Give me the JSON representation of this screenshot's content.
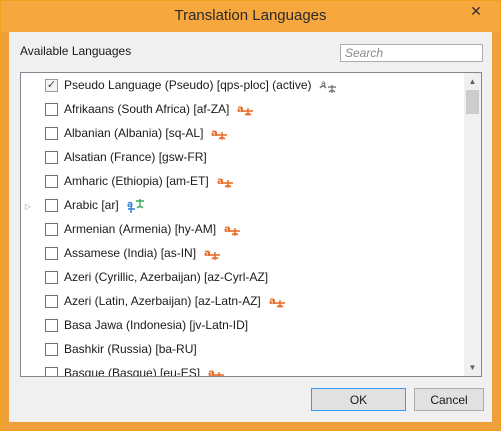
{
  "window": {
    "title": "Translation Languages",
    "close_glyph": "✕"
  },
  "available_label": "Available Languages",
  "search": {
    "placeholder": "Search",
    "value": ""
  },
  "languages": [
    {
      "label": "Pseudo Language (Pseudo) [qps-ploc] (active)",
      "checked": true,
      "icon": "translate-gray-icon",
      "expandable": false
    },
    {
      "label": "Afrikaans (South Africa) [af-ZA]",
      "checked": false,
      "icon": "translate-orange-icon",
      "expandable": false
    },
    {
      "label": "Albanian (Albania) [sq-AL]",
      "checked": false,
      "icon": "translate-orange-icon",
      "expandable": false
    },
    {
      "label": "Alsatian (France) [gsw-FR]",
      "checked": false,
      "icon": "",
      "expandable": false
    },
    {
      "label": "Amharic (Ethiopia) [am-ET]",
      "checked": false,
      "icon": "translate-orange-icon",
      "expandable": false
    },
    {
      "label": "Arabic [ar]",
      "checked": false,
      "icon": "translate-multi-icon",
      "expandable": true
    },
    {
      "label": "Armenian (Armenia) [hy-AM]",
      "checked": false,
      "icon": "translate-orange-icon",
      "expandable": false
    },
    {
      "label": "Assamese (India) [as-IN]",
      "checked": false,
      "icon": "translate-orange-icon",
      "expandable": false
    },
    {
      "label": "Azeri (Cyrillic, Azerbaijan) [az-Cyrl-AZ]",
      "checked": false,
      "icon": "",
      "expandable": false
    },
    {
      "label": "Azeri (Latin, Azerbaijan) [az-Latn-AZ]",
      "checked": false,
      "icon": "translate-orange-icon",
      "expandable": false
    },
    {
      "label": "Basa Jawa (Indonesia) [jv-Latn-ID]",
      "checked": false,
      "icon": "",
      "expandable": false
    },
    {
      "label": "Bashkir (Russia) [ba-RU]",
      "checked": false,
      "icon": "",
      "expandable": false
    },
    {
      "label": "Basque (Basque) [eu-ES]",
      "checked": false,
      "icon": "translate-orange-icon",
      "expandable": false
    }
  ],
  "buttons": {
    "ok": "OK",
    "cancel": "Cancel"
  },
  "colors": {
    "accent": "#f6a73d",
    "translate_orange": "#e8641e",
    "translate_blue": "#2d7bd6",
    "translate_green": "#3aa655"
  }
}
